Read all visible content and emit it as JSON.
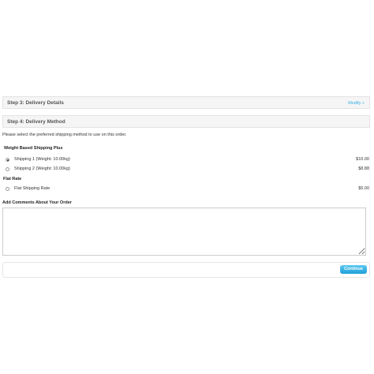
{
  "step3": {
    "title": "Step 3: Delivery Details",
    "modify_label": "Modify »"
  },
  "step4": {
    "title": "Step 4: Delivery Method"
  },
  "intro": "Please select the preferred shipping method to use on this order.",
  "groups": [
    {
      "title": "Weight Based Shipping Plus",
      "options": [
        {
          "label": "Shipping 1 (Weight: 10.00kg)",
          "price": "$10.00",
          "selected": true
        },
        {
          "label": "Shipping 2 (Weight: 10.00kg)",
          "price": "$8.88",
          "selected": false
        }
      ]
    },
    {
      "title": "Flat Rate",
      "options": [
        {
          "label": "Flat Shipping Rate",
          "price": "$5.00",
          "selected": false
        }
      ]
    }
  ],
  "comments": {
    "label": "Add Comments About Your Order",
    "value": ""
  },
  "continue_label": "Continue",
  "colors": {
    "accent": "#38b0e3",
    "button": "#1f9fd8",
    "panel": "#f5f5f5"
  }
}
